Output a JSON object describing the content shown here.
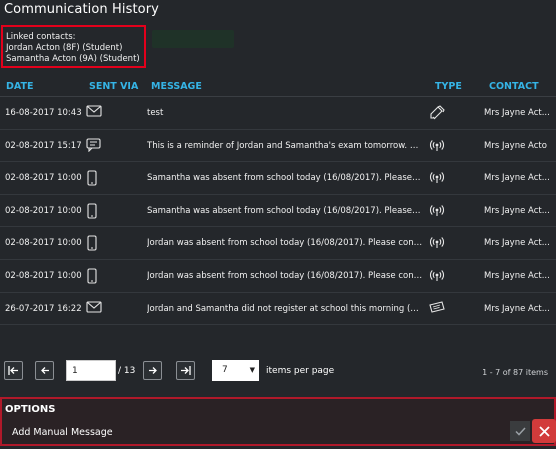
{
  "window": {
    "title": "Communication History"
  },
  "linked": {
    "heading": "Linked contacts:",
    "contacts": [
      "Jordan Acton (8F) (Student)",
      "Samantha Acton (9A) (Student)"
    ]
  },
  "table": {
    "headers": {
      "date": "DATE",
      "sent_via": "SENT VIA",
      "message": "MESSAGE",
      "type": "TYPE",
      "contact": "CONTACT"
    },
    "rows": [
      {
        "date": "16-08-2017 10:43",
        "sent_via_icon": "email-icon",
        "message": "test",
        "type_icon": "manual-message-icon",
        "contact": "Mrs Jayne Act..."
      },
      {
        "date": "02-08-2017 15:17",
        "sent_via_icon": "chat-icon",
        "message": "This is a reminder of Jordan and Samantha's exam tomorrow. Plea...",
        "type_icon": "broadcast-icon",
        "contact": "Mrs Jayne Acto"
      },
      {
        "date": "02-08-2017 10:00",
        "sent_via_icon": "mobile-icon",
        "message": "Samantha was absent from school today (16/08/2017). Please cont...",
        "type_icon": "broadcast-icon",
        "contact": "Mrs Jayne Act..."
      },
      {
        "date": "02-08-2017 10:00",
        "sent_via_icon": "mobile-icon",
        "message": "Samantha was absent from school today (16/08/2017). Please cont...",
        "type_icon": "broadcast-icon",
        "contact": "Mrs Jayne Act..."
      },
      {
        "date": "02-08-2017 10:00",
        "sent_via_icon": "mobile-icon",
        "message": "Jordan was absent from school today (16/08/2017). Please contact ...",
        "type_icon": "broadcast-icon",
        "contact": "Mrs Jayne Act..."
      },
      {
        "date": "02-08-2017 10:00",
        "sent_via_icon": "mobile-icon",
        "message": "Jordan was absent from school today (16/08/2017). Please contact ...",
        "type_icon": "broadcast-icon",
        "contact": "Mrs Jayne Act..."
      },
      {
        "date": "26-07-2017 16:22",
        "sent_via_icon": "email-icon",
        "message": "Jordan and Samantha did not register at school this morning (16/0...",
        "type_icon": "ticket-icon",
        "contact": "Mrs Jayne Act..."
      }
    ]
  },
  "pager": {
    "page_value": "1",
    "total": "/ 13",
    "per_page": "7",
    "per_page_label": "items per page",
    "range": "1 - 7 of 87 items"
  },
  "options": {
    "title": "OPTIONS",
    "item": "Add Manual Message"
  },
  "colors": {
    "accent": "#35b4e6",
    "highlight": "#e3001b",
    "close": "#d23b3b",
    "background": "#24272b"
  }
}
